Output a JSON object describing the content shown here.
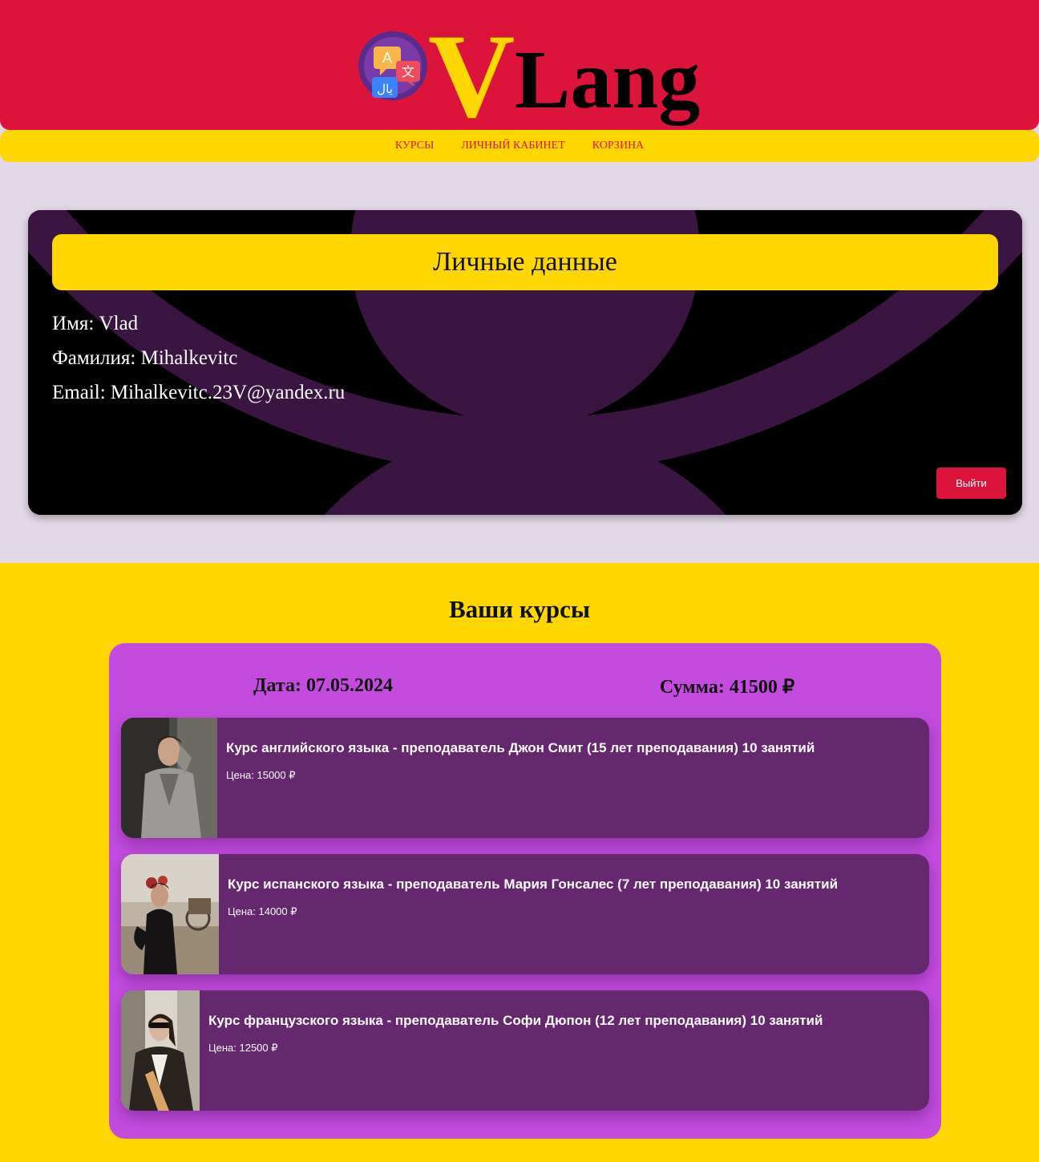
{
  "brand": {
    "letter": "V",
    "word": "Lang"
  },
  "nav": {
    "items": [
      {
        "label": "КУРСЫ"
      },
      {
        "label": "ЛИЧНЫЙ КАБИНЕТ"
      },
      {
        "label": "КОРЗИНА"
      }
    ]
  },
  "profile": {
    "title": "Личные данные",
    "name_line": "Имя: Vlad",
    "surname_line": "Фамилия: Mihalkevitc",
    "email_line": "Email: Mihalkevitc.23V@yandex.ru",
    "logout_label": "Выйти"
  },
  "courses": {
    "heading": "Ваши курсы",
    "order": {
      "date": "Дата: 07.05.2024",
      "sum": "Сумма: 41500 ₽",
      "items": [
        {
          "name": "Курс английского языка - преподаватель Джон Смит (15 лет преподавания) 10 занятий",
          "price": "Цена: 15000 ₽"
        },
        {
          "name": "Курс испанского языка - преподаватель Мария Гонсалес (7 лет преподавания) 10 занятий",
          "price": "Цена: 14000 ₽"
        },
        {
          "name": "Курс французского языка - преподаватель Софи Дюпон (12 лет преподавания) 10 занятий",
          "price": "Цена: 12500 ₽"
        }
      ]
    }
  },
  "colors": {
    "header": "#dc143c",
    "accent": "#ffd700",
    "page_bg": "#e2d9e6",
    "order_bg": "#c34cdf",
    "course_bg": "#65286f"
  }
}
